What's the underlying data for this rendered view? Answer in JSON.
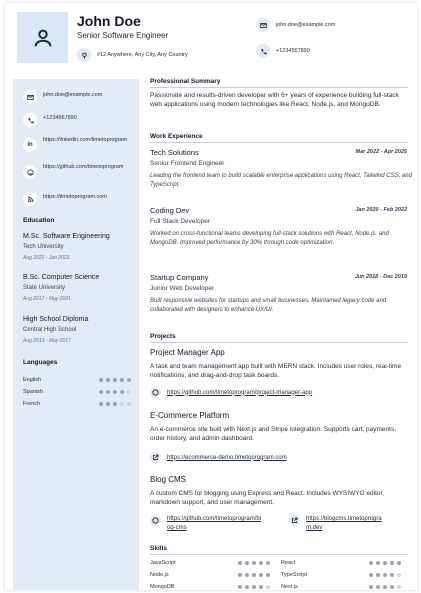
{
  "header": {
    "name": "John Doe",
    "title": "Senior Software Engineer",
    "address": "#12 Anywhere, Any City, Any Country",
    "email": "john.doe@example.com",
    "phone": "+1234567890"
  },
  "sidebar": {
    "contacts": [
      {
        "icon": "mail-icon",
        "text": "john.doe@example.com"
      },
      {
        "icon": "phone-icon",
        "text": "+1234567890"
      },
      {
        "icon": "linkedin-icon",
        "text": "https://linkedin.com/timetoprogram"
      },
      {
        "icon": "github-icon",
        "text": "https://github.com/timetoprogram"
      },
      {
        "icon": "rss-icon",
        "text": "https://timetoprogram.com"
      }
    ],
    "education_heading": "Education",
    "education": [
      {
        "degree": "M.Sc. Software Engineering",
        "school": "Tech University",
        "dates": "Aug 2021 - Jun 2023"
      },
      {
        "degree": "B.Sc. Computer Science",
        "school": "State University",
        "dates": "Aug 2017 - May 2021"
      },
      {
        "degree": "High School Diploma",
        "school": "Central High School",
        "dates": "Aug 2013 - May 2017"
      }
    ],
    "languages_heading": "Languages",
    "languages": [
      {
        "name": "English",
        "level": 5
      },
      {
        "name": "Spanish",
        "level": 4
      },
      {
        "name": "French",
        "level": 3
      }
    ]
  },
  "summary": {
    "heading": "Professional Summary",
    "text": "Passionate and results-driven developer with 6+ years of experience building full-stack web applications using modern technologies like React, Node.js, and MongoDB."
  },
  "experience": {
    "heading": "Work Experience",
    "jobs": [
      {
        "company": "Tech Solutions",
        "role": "Senior Frontend Engineer",
        "dates": "Mar 2022 - Apr 2025",
        "desc": "Leading the frontend team to build scalable enterprise applications using React, Tailwind CSS, and TypeScript."
      },
      {
        "company": "Coding Dev",
        "role": "Full Stack Developer",
        "dates": "Jan 2020 - Feb 2022",
        "desc": "Worked on cross-functional teams developing full-stack solutions with React, Node.js, and MongoDB. Improved performance by 30% through code optimization."
      },
      {
        "company": "Startup Company",
        "role": "Junior Web Developer",
        "dates": "Jun 2018 - Dec 2019",
        "desc": "Built responsive websites for startups and small businesses. Maintained legacy code and collaborated with designers to enhance UX/UI."
      }
    ]
  },
  "projects": {
    "heading": "Projects",
    "items": [
      {
        "title": "Project Manager App",
        "desc": "A task and team management app built with MERN stack. Includes user roles, real-time notifications, and drag-and-drop task boards.",
        "link1": "https://github.com/timetoprogram/project-manager-app"
      },
      {
        "title": "E-Commerce Platform",
        "desc": "An e-commerce site built with Next.js and Stripe integration. Supports cart, payments, order history, and admin dashboard.",
        "link1": "https://ecommerce-demo.timetoprogram.com"
      },
      {
        "title": "Blog CMS",
        "desc": "A custom CMS for blogging using Express and React. Includes WYSIWYG editor, markdown support, and user management.",
        "link1a": "https://github.com/timetoprogram/bl",
        "link1b": "og-cms",
        "link2a": "https://blogcms.timetoprogra",
        "link2b": "m.dev"
      }
    ]
  },
  "skills": {
    "heading": "Skills",
    "items": [
      {
        "name": "JavaScript",
        "level": 5
      },
      {
        "name": "React",
        "level": 5
      },
      {
        "name": "Node.js",
        "level": 5
      },
      {
        "name": "TypeScript",
        "level": 4
      },
      {
        "name": "MongoDB",
        "level": 4
      },
      {
        "name": "Next.js",
        "level": 4
      }
    ]
  },
  "colors": {
    "sidebar": "#e3ebf7",
    "avatar_bg": "#dbe6f7",
    "accent": "#3b6fd8"
  }
}
